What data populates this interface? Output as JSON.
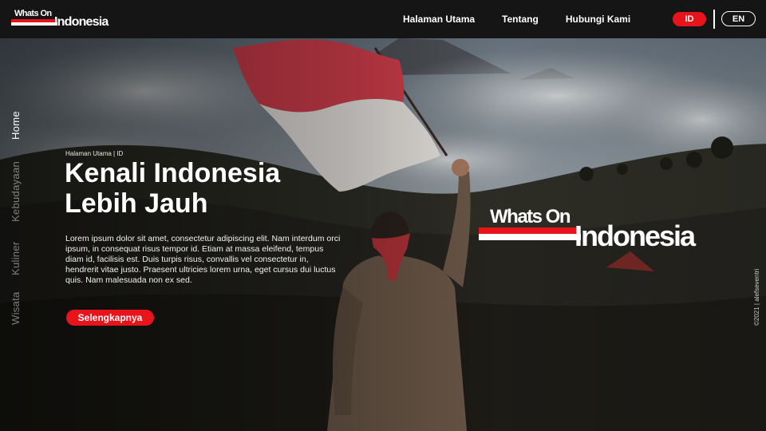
{
  "brand": {
    "line1": "Whats On",
    "line2": "Indonesia"
  },
  "nav": {
    "links": [
      "Halaman Utama",
      "Tentang",
      "Hubungi Kami"
    ],
    "lang_active": "ID",
    "lang_other": "EN"
  },
  "side_nav": [
    "Home",
    "Kebudayaan",
    "Kuliner",
    "Wisata"
  ],
  "hero": {
    "breadcrumb": "Halaman Utama | ID",
    "title_line1": "Kenali Indonesia",
    "title_line2": "Lebih Jauh",
    "body": "Lorem ipsum dolor sit amet, consectetur adipiscing elit. Nam interdum orci ipsum, in consequat risus tempor id. Etiam at massa eleifend, tempus diam id, facilisis est. Duis turpis risus, convallis vel consectetur in, hendrerit vitae justo. Praesent ultricies lorem urna, eget cursus dui luctus quis. Nam malesuada non ex sed.",
    "cta_label": "Selengkapnya"
  },
  "big_logo": {
    "line1": "Whats On",
    "line2": "Indonesia"
  },
  "credit": "©2021 | alefseventri",
  "colors": {
    "accent": "#e8141b",
    "navbar": "#151515",
    "text": "#ffffff"
  }
}
